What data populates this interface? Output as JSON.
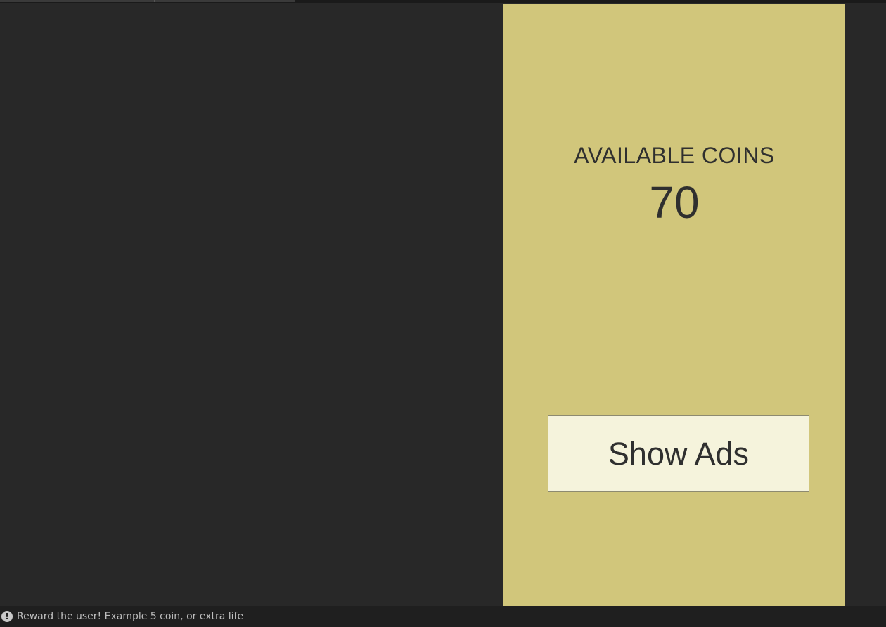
{
  "game": {
    "coins_label": "AVAILABLE COINS",
    "coins_value": "70",
    "show_ads_label": "Show Ads"
  },
  "status_bar": {
    "icon": "warning-icon",
    "message": "Reward the user! Example 5 coin, or extra life"
  },
  "colors": {
    "editor_background": "#282828",
    "game_background": "#d1c67b",
    "button_background": "#f5f3dc",
    "text": "#2f2f2f"
  }
}
